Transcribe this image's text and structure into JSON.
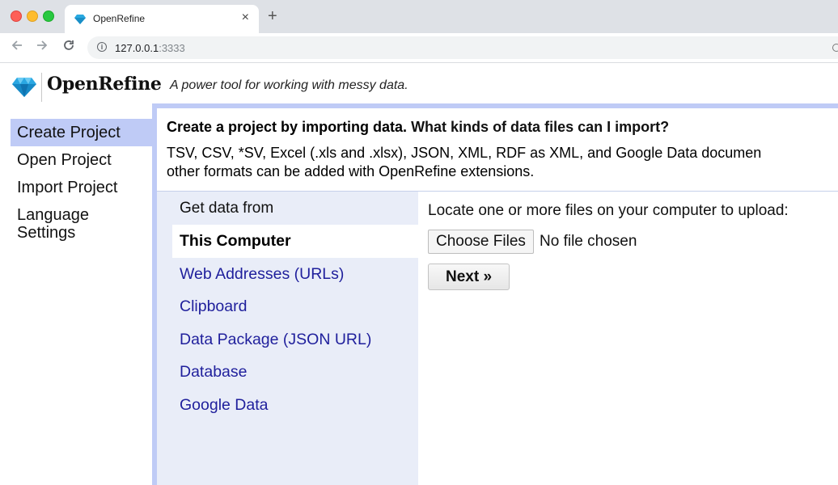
{
  "browser": {
    "tab_title": "OpenRefine",
    "tab_close": "×",
    "new_tab": "+",
    "url_host": "127.0.0.1",
    "url_port": ":3333"
  },
  "app": {
    "logo_text": "OpenRefine",
    "tagline": "A power tool for working with messy data."
  },
  "leftnav": {
    "items": [
      {
        "label": "Create Project",
        "selected": true
      },
      {
        "label": "Open Project"
      },
      {
        "label": "Import Project"
      },
      {
        "label": "Language Settings"
      }
    ]
  },
  "main": {
    "heading_prefix": "Create a project by importing data. ",
    "heading_link": "What kinds of data files can I import?",
    "formats_line1": "TSV, CSV, *SV, Excel (.xls and .xlsx), JSON, XML, RDF as XML, and Google Data documen",
    "formats_line2": "other formats can be added with OpenRefine extensions.",
    "sources_title": "Get data from",
    "sources": [
      {
        "label": "This Computer",
        "selected": true
      },
      {
        "label": "Web Addresses (URLs)"
      },
      {
        "label": "Clipboard"
      },
      {
        "label": "Data Package (JSON URL)"
      },
      {
        "label": "Database"
      },
      {
        "label": "Google Data"
      }
    ],
    "upload_prompt": "Locate one or more files on your computer to upload:",
    "choose_files": "Choose Files",
    "no_file": "No file chosen",
    "next": "Next »"
  },
  "colors": {
    "accent": "#bfcbf6",
    "link": "#1f1f9c",
    "sources_bg": "#e9edf8"
  }
}
